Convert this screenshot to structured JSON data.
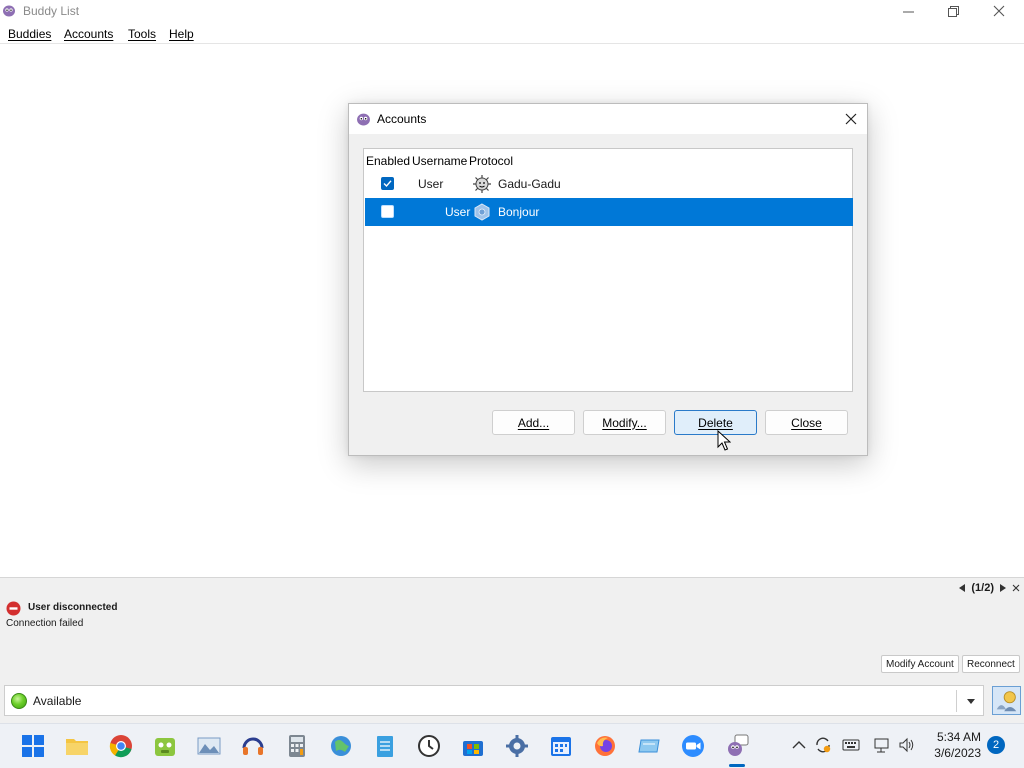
{
  "window": {
    "title": "Buddy List",
    "menu": [
      "Buddies",
      "Accounts",
      "Tools",
      "Help"
    ]
  },
  "dialog": {
    "title": "Accounts",
    "columns": [
      "Enabled",
      "Username",
      "Protocol"
    ],
    "rows": [
      {
        "enabled": true,
        "username": "User",
        "protocol": "Gadu-Gadu",
        "protocol_icon": "gadu-gadu-icon",
        "selected": false
      },
      {
        "enabled": false,
        "username": "User",
        "protocol": "Bonjour",
        "protocol_icon": "bonjour-icon",
        "selected": true
      }
    ],
    "buttons": {
      "add": "Add...",
      "modify": "Modify...",
      "delete": "Delete",
      "close": "Close"
    }
  },
  "status_panel": {
    "pager": "(1/2)",
    "error_title": "User disconnected",
    "error_detail": "Connection failed",
    "modify_account": "Modify Account",
    "reconnect": "Reconnect",
    "current_status": "Available"
  },
  "taskbar": {
    "time": "5:34 AM",
    "date": "3/6/2023",
    "notifications": "2"
  },
  "colors": {
    "selection": "#0078d7",
    "accent": "#0067c0",
    "available": "#6ccf29",
    "error": "#d32f2f"
  }
}
